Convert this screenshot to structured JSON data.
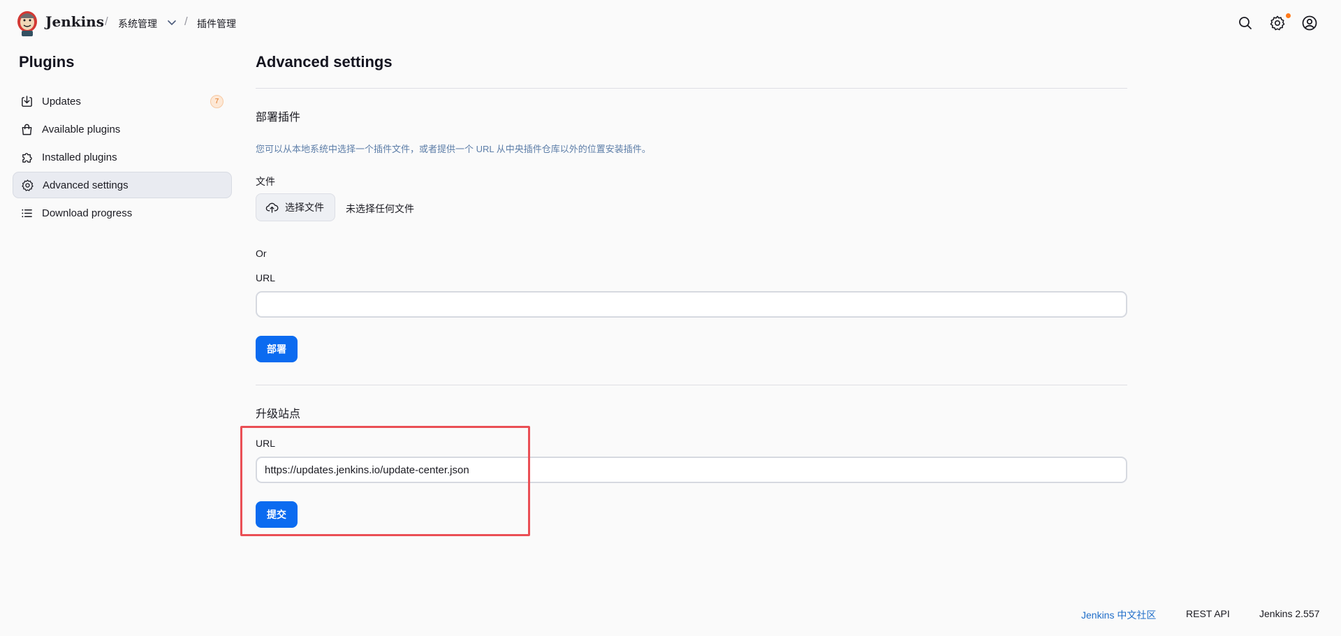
{
  "header": {
    "brand": "Jenkins",
    "breadcrumb": [
      "系统管理",
      "插件管理"
    ],
    "icons": [
      "search-icon",
      "gear-icon",
      "user-icon"
    ],
    "notification_color": "#ff7a1a"
  },
  "sidebar": {
    "title": "Plugins",
    "items": [
      {
        "label": "Updates",
        "icon": "download-icon",
        "badge": "7"
      },
      {
        "label": "Available plugins",
        "icon": "shopping-bag-icon"
      },
      {
        "label": "Installed plugins",
        "icon": "puzzle-icon"
      },
      {
        "label": "Advanced settings",
        "icon": "gear-icon",
        "active": true
      },
      {
        "label": "Download progress",
        "icon": "list-icon"
      }
    ]
  },
  "main": {
    "title": "Advanced settings",
    "deploy": {
      "title": "部署插件",
      "description": "您可以从本地系统中选择一个插件文件，或者提供一个 URL 从中央插件仓库以外的位置安装插件。",
      "file_label": "文件",
      "file_button": "选择文件",
      "file_status": "未选择任何文件",
      "or": "Or",
      "url_label": "URL",
      "url_value": "",
      "button": "部署"
    },
    "update_site": {
      "title": "升级站点",
      "url_label": "URL",
      "url_value": "https://updates.jenkins.io/update-center.json",
      "button": "提交"
    }
  },
  "footer": {
    "community": "Jenkins 中文社区",
    "rest_api": "REST API",
    "version": "Jenkins 2.557"
  },
  "colors": {
    "primary": "#0b6bf0",
    "highlight": "#ea4f55",
    "link": "#1f6ec9"
  }
}
